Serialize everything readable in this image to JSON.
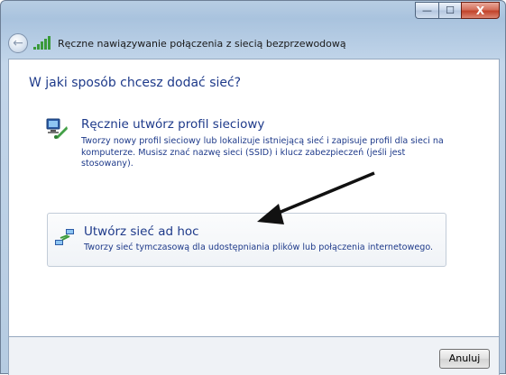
{
  "window": {
    "nav_title": "Ręczne nawiązywanie połączenia z siecią bezprzewodową",
    "buttons": {
      "minimize_glyph": "—",
      "maximize_glyph": "☐",
      "close_glyph": "X"
    }
  },
  "main": {
    "heading": "W jaki sposób chcesz dodać sieć?",
    "options": [
      {
        "title": "Ręcznie utwórz profil sieciowy",
        "description": "Tworzy nowy profil sieciowy lub lokalizuje istniejącą sieć i zapisuje profil dla sieci na komputerze. Musisz znać nazwę sieci (SSID) i klucz zabezpieczeń (jeśli jest stosowany).",
        "icon": "network-profile-icon"
      },
      {
        "title": "Utwórz sieć ad hoc",
        "description": "Tworzy sieć tymczasową dla  udostępniania plików lub połączenia internetowego.",
        "icon": "ad-hoc-network-icon"
      }
    ]
  },
  "footer": {
    "cancel_label": "Anuluj"
  },
  "colors": {
    "link_blue": "#1e3a8a",
    "close_red": "#c2432a"
  }
}
